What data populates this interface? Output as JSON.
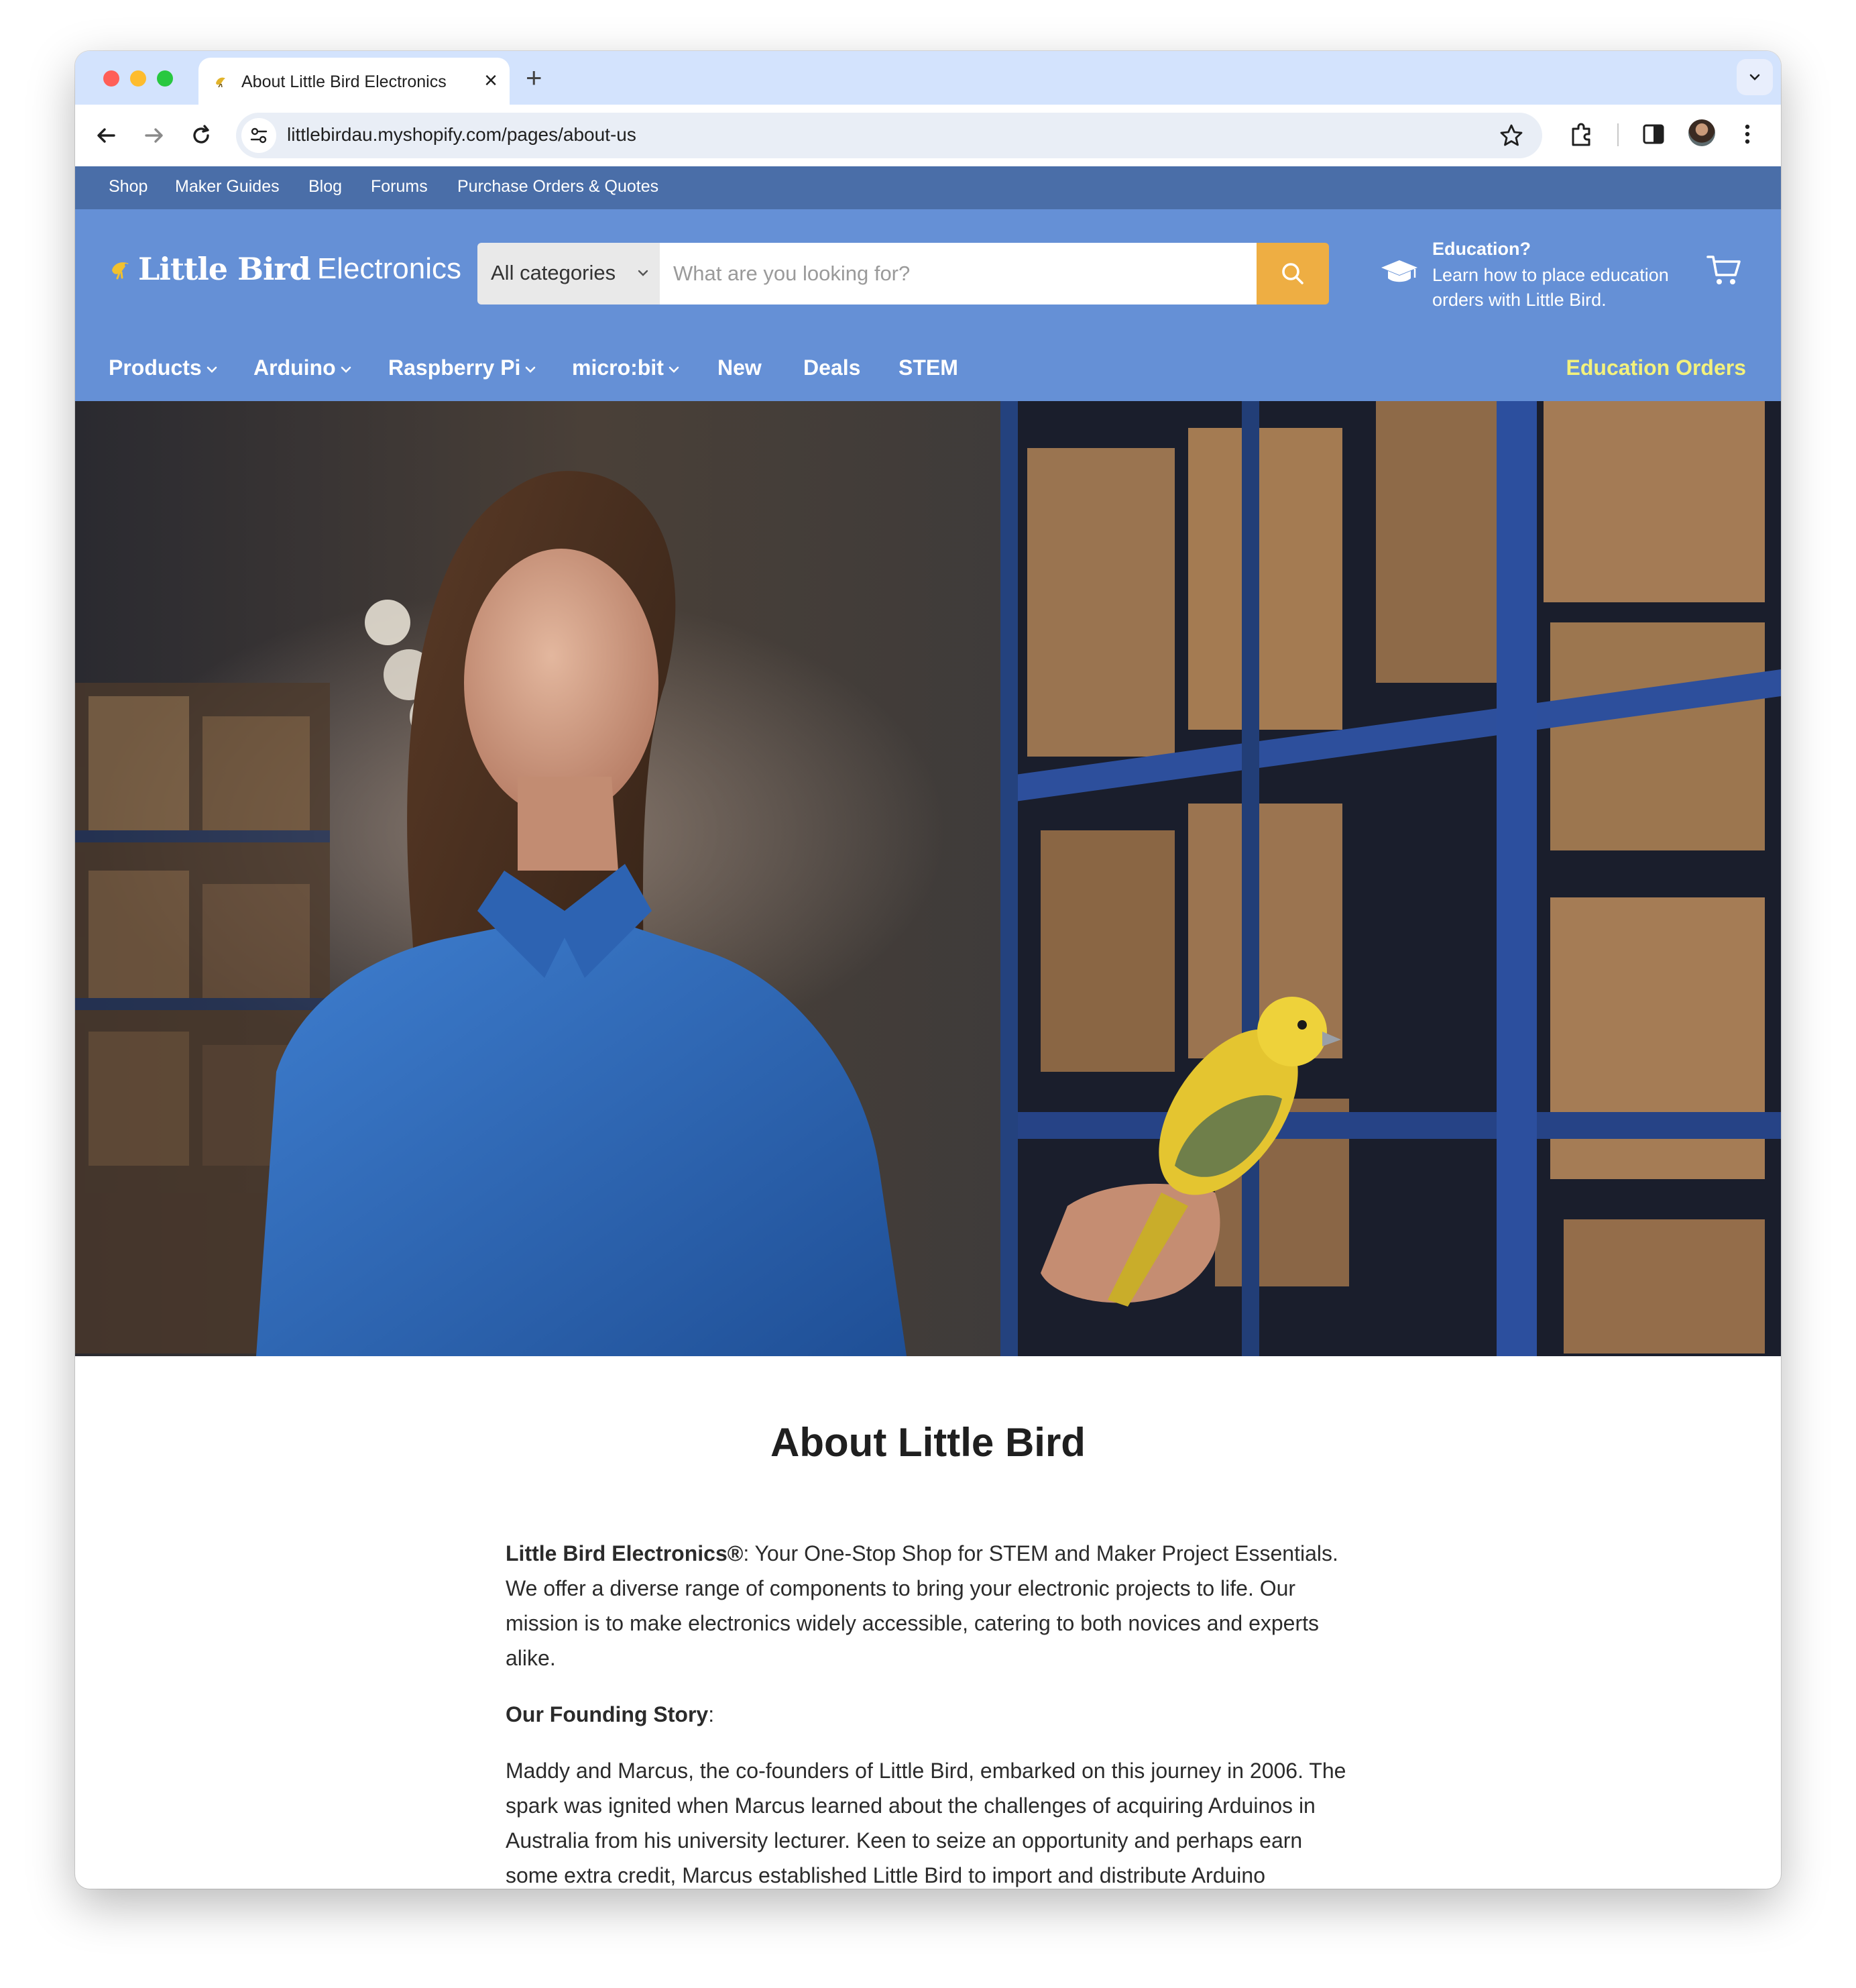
{
  "browser": {
    "tab_title": "About Little Bird Electronics",
    "url": "littlebirdau.myshopify.com/pages/about-us"
  },
  "site": {
    "top_links": [
      "Shop",
      "Maker Guides",
      "Blog",
      "Forums",
      "Purchase Orders & Quotes"
    ],
    "logo_bold": "Little Bird",
    "logo_light": "Electronics",
    "category_select": "All categories",
    "search_placeholder": "What are you looking for?",
    "education_title": "Education?",
    "education_text": "Learn how to place education orders with Little Bird.",
    "nav": {
      "products": "Products",
      "arduino": "Arduino",
      "raspberry_pi": "Raspberry Pi",
      "microbit": "micro:bit",
      "new": "New",
      "deals": "Deals",
      "stem": "STEM",
      "education_orders": "Education Orders"
    },
    "colors": {
      "topbar": "#4a6ea8",
      "header": "#6590d6",
      "search_button": "#eeae43",
      "education_orders": "#f3f17c"
    }
  },
  "content": {
    "title": "About Little Bird",
    "intro_bold": "Little Bird Electronics®",
    "intro_text": ": Your One-Stop Shop for STEM and Maker Project Essentials. We offer a diverse range of components to bring your electronic projects to life. Our mission is to make electronics widely accessible, catering to both novices and experts alike.",
    "founding_heading": "Our Founding Story",
    "founding_colon": ":",
    "founding_text": "Maddy and Marcus, the co-founders of Little Bird, embarked on this journey in 2006. The spark was ignited when Marcus learned about the challenges of acquiring Arduinos in Australia from his university lecturer. Keen to seize an opportunity and perhaps earn some extra credit, Marcus established Little Bird to import and distribute Arduino"
  }
}
